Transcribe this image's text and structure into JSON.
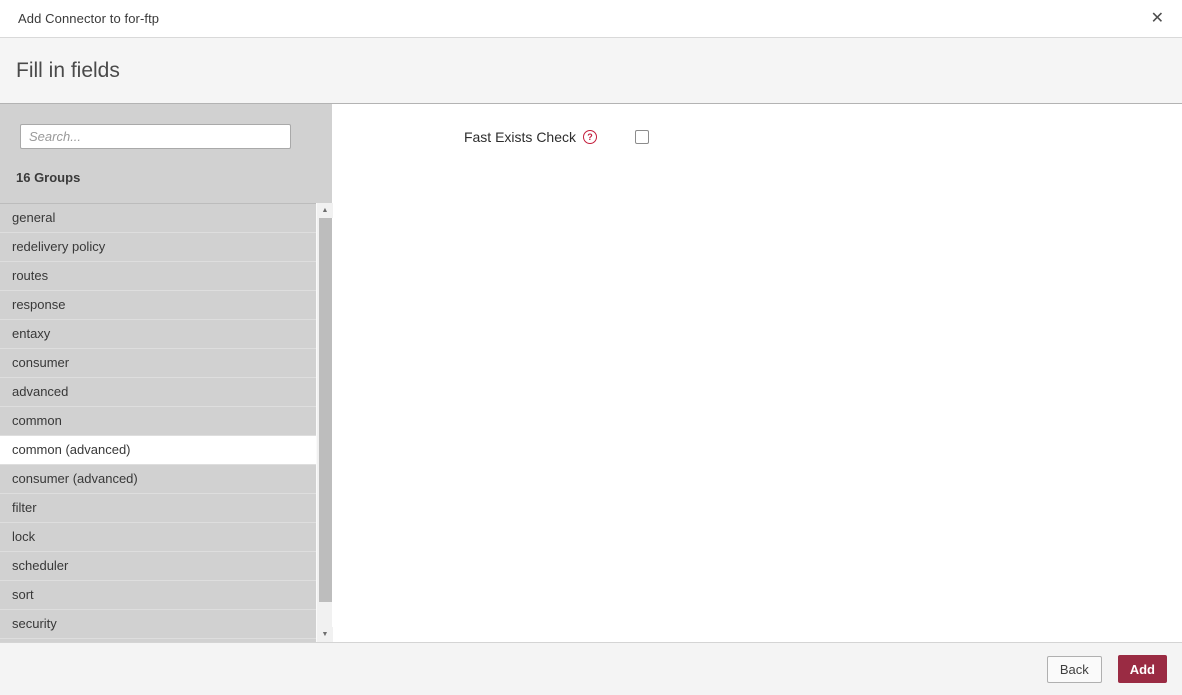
{
  "dialog": {
    "title": "Add Connector to for-ftp",
    "subtitle": "Fill in fields",
    "close_glyph": "✕"
  },
  "sidebar": {
    "search": {
      "placeholder": "Search...",
      "value": ""
    },
    "groups_count": "16 Groups",
    "selected_group": "common (advanced)",
    "groups": [
      "general",
      "redelivery policy",
      "routes",
      "response",
      "entaxy",
      "consumer",
      "advanced",
      "common",
      "common (advanced)",
      "consumer (advanced)",
      "filter",
      "lock",
      "scheduler",
      "sort",
      "security"
    ],
    "scrollbar": {
      "up_glyph": "▲",
      "down_glyph": "▼"
    }
  },
  "form": {
    "fields": [
      {
        "label": "Fast Exists Check",
        "help_glyph": "?",
        "control": "checkbox",
        "checked": false
      }
    ]
  },
  "footer": {
    "back_label": "Back",
    "add_label": "Add"
  },
  "colors": {
    "accent": "#9a2b43",
    "help_icon": "#c41e3c",
    "sidebar_bg": "#d1d1d1",
    "selected_item_bg": "#ffffff",
    "panel_bg": "#f4f4f4"
  }
}
